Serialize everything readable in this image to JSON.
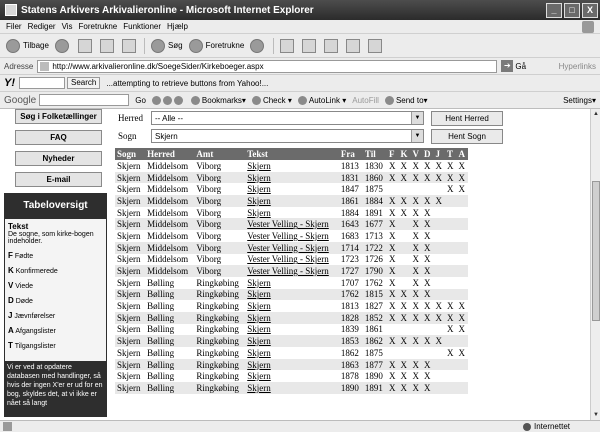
{
  "window": {
    "title": "Statens Arkivers Arkivalieronline - Microsoft Internet Explorer",
    "min": "_",
    "max": "□",
    "close": "X"
  },
  "menu": [
    "Filer",
    "Rediger",
    "Vis",
    "Foretrukne",
    "Funktioner",
    "Hjælp"
  ],
  "toolbar": {
    "back": "Tilbage",
    "search": "Søg",
    "favorites": "Foretrukne"
  },
  "address": {
    "label": "Adresse",
    "url": "http://www.arkivalieronline.dk/SoegeSider/Kirkeboeger.aspx",
    "go": "Gå",
    "links": "Hyperlinks"
  },
  "yahoo": {
    "logo": "Y!",
    "search_btn": "Search",
    "message": "...attempting to retrieve buttons from Yahoo!..."
  },
  "google": {
    "logo": "Google",
    "go": "Go",
    "bookmarks": "Bookmarks▾",
    "check": "Check ▾",
    "autolink": "AutoLink ▾",
    "autofill": "AutoFill",
    "sendto": "Send to▾",
    "settings": "Settings▾"
  },
  "sidebar": {
    "buttons": [
      "Søg i Folketællinger",
      "FAQ",
      "Nyheder",
      "E-mail"
    ],
    "panel_title": "Tabeloversigt",
    "tekst_title": "Tekst",
    "tekst_desc": "De sogne, som kirke-bogen indeholder.",
    "legend": [
      {
        "key": "F",
        "label": "Fødte"
      },
      {
        "key": "K",
        "label": "Konfirmerede"
      },
      {
        "key": "V",
        "label": "Viede"
      },
      {
        "key": "D",
        "label": "Døde"
      },
      {
        "key": "J",
        "label": "Jævnførelser"
      },
      {
        "key": "A",
        "label": "Afgangslister"
      },
      {
        "key": "T",
        "label": "Tilgangslister"
      }
    ],
    "foot": "Vi er ved at opdatere databasen med handlinger, så hvis der ingen X'er er ud for en bog, skyldes det, at vi ikke er nået så langt"
  },
  "form": {
    "herred_label": "Herred",
    "herred_value": "-- Alle --",
    "herred_button": "Hent Herred",
    "sogn_label": "Sogn",
    "sogn_value": "Skjern",
    "sogn_button": "Hent Sogn"
  },
  "table": {
    "headers": [
      "Sogn",
      "Herred",
      "Amt",
      "Tekst",
      "Fra",
      "Til",
      "F",
      "K",
      "V",
      "D",
      "J",
      "T",
      "A"
    ],
    "rows": [
      [
        "Skjern",
        "Middelsom",
        "Viborg",
        "Skjern",
        "1813",
        "1830",
        "X",
        "X",
        "X",
        "X",
        "X",
        "X",
        "X"
      ],
      [
        "Skjern",
        "Middelsom",
        "Viborg",
        "Skjern",
        "1831",
        "1860",
        "X",
        "X",
        "X",
        "X",
        "X",
        "X",
        "X"
      ],
      [
        "Skjern",
        "Middelsom",
        "Viborg",
        "Skjern",
        "1847",
        "1875",
        "",
        "",
        "",
        "",
        "",
        "X",
        "X"
      ],
      [
        "Skjern",
        "Middelsom",
        "Viborg",
        "Skjern",
        "1861",
        "1884",
        "X",
        "X",
        "X",
        "X",
        "X",
        "",
        ""
      ],
      [
        "Skjern",
        "Middelsom",
        "Viborg",
        "Skjern",
        "1884",
        "1891",
        "X",
        "X",
        "X",
        "X",
        "",
        "",
        ""
      ],
      [
        "Skjern",
        "Middelsom",
        "Viborg",
        "Vester Velling - Skjern",
        "1643",
        "1677",
        "X",
        "",
        "X",
        "X",
        "",
        "",
        ""
      ],
      [
        "Skjern",
        "Middelsom",
        "Viborg",
        "Vester Velling - Skjern",
        "1683",
        "1713",
        "X",
        "",
        "X",
        "X",
        "",
        "",
        ""
      ],
      [
        "Skjern",
        "Middelsom",
        "Viborg",
        "Vester Velling - Skjern",
        "1714",
        "1722",
        "X",
        "",
        "X",
        "X",
        "",
        "",
        ""
      ],
      [
        "Skjern",
        "Middelsom",
        "Viborg",
        "Vester Velling - Skjern",
        "1723",
        "1726",
        "X",
        "",
        "X",
        "X",
        "",
        "",
        ""
      ],
      [
        "Skjern",
        "Middelsom",
        "Viborg",
        "Vester Velling - Skjern",
        "1727",
        "1790",
        "X",
        "",
        "X",
        "X",
        "",
        "",
        ""
      ],
      [
        "Skjern",
        "Bølling",
        "Ringkøbing",
        "Skjern",
        "1707",
        "1762",
        "X",
        "",
        "X",
        "X",
        "",
        "",
        ""
      ],
      [
        "Skjern",
        "Bølling",
        "Ringkøbing",
        "Skjern",
        "1762",
        "1815",
        "X",
        "X",
        "X",
        "X",
        "",
        "",
        ""
      ],
      [
        "Skjern",
        "Bølling",
        "Ringkøbing",
        "Skjern",
        "1813",
        "1827",
        "X",
        "X",
        "X",
        "X",
        "X",
        "X",
        "X"
      ],
      [
        "Skjern",
        "Bølling",
        "Ringkøbing",
        "Skjern",
        "1828",
        "1852",
        "X",
        "X",
        "X",
        "X",
        "X",
        "X",
        "X"
      ],
      [
        "Skjern",
        "Bølling",
        "Ringkøbing",
        "Skjern",
        "1839",
        "1861",
        "",
        "",
        "",
        "",
        "",
        "X",
        "X"
      ],
      [
        "Skjern",
        "Bølling",
        "Ringkøbing",
        "Skjern",
        "1853",
        "1862",
        "X",
        "X",
        "X",
        "X",
        "X",
        "",
        ""
      ],
      [
        "Skjern",
        "Bølling",
        "Ringkøbing",
        "Skjern",
        "1862",
        "1875",
        "",
        "",
        "",
        "",
        "",
        "X",
        "X"
      ],
      [
        "Skjern",
        "Bølling",
        "Ringkøbing",
        "Skjern",
        "1863",
        "1877",
        "X",
        "X",
        "X",
        "X",
        "",
        "",
        ""
      ],
      [
        "Skjern",
        "Bølling",
        "Ringkøbing",
        "Skjern",
        "1878",
        "1890",
        "X",
        "X",
        "X",
        "X",
        "",
        "",
        ""
      ],
      [
        "Skjern",
        "Bølling",
        "Ringkøbing",
        "Skjern",
        "1890",
        "1891",
        "X",
        "X",
        "X",
        "X",
        "",
        "",
        ""
      ]
    ]
  },
  "status": {
    "zone": "Internettet"
  }
}
